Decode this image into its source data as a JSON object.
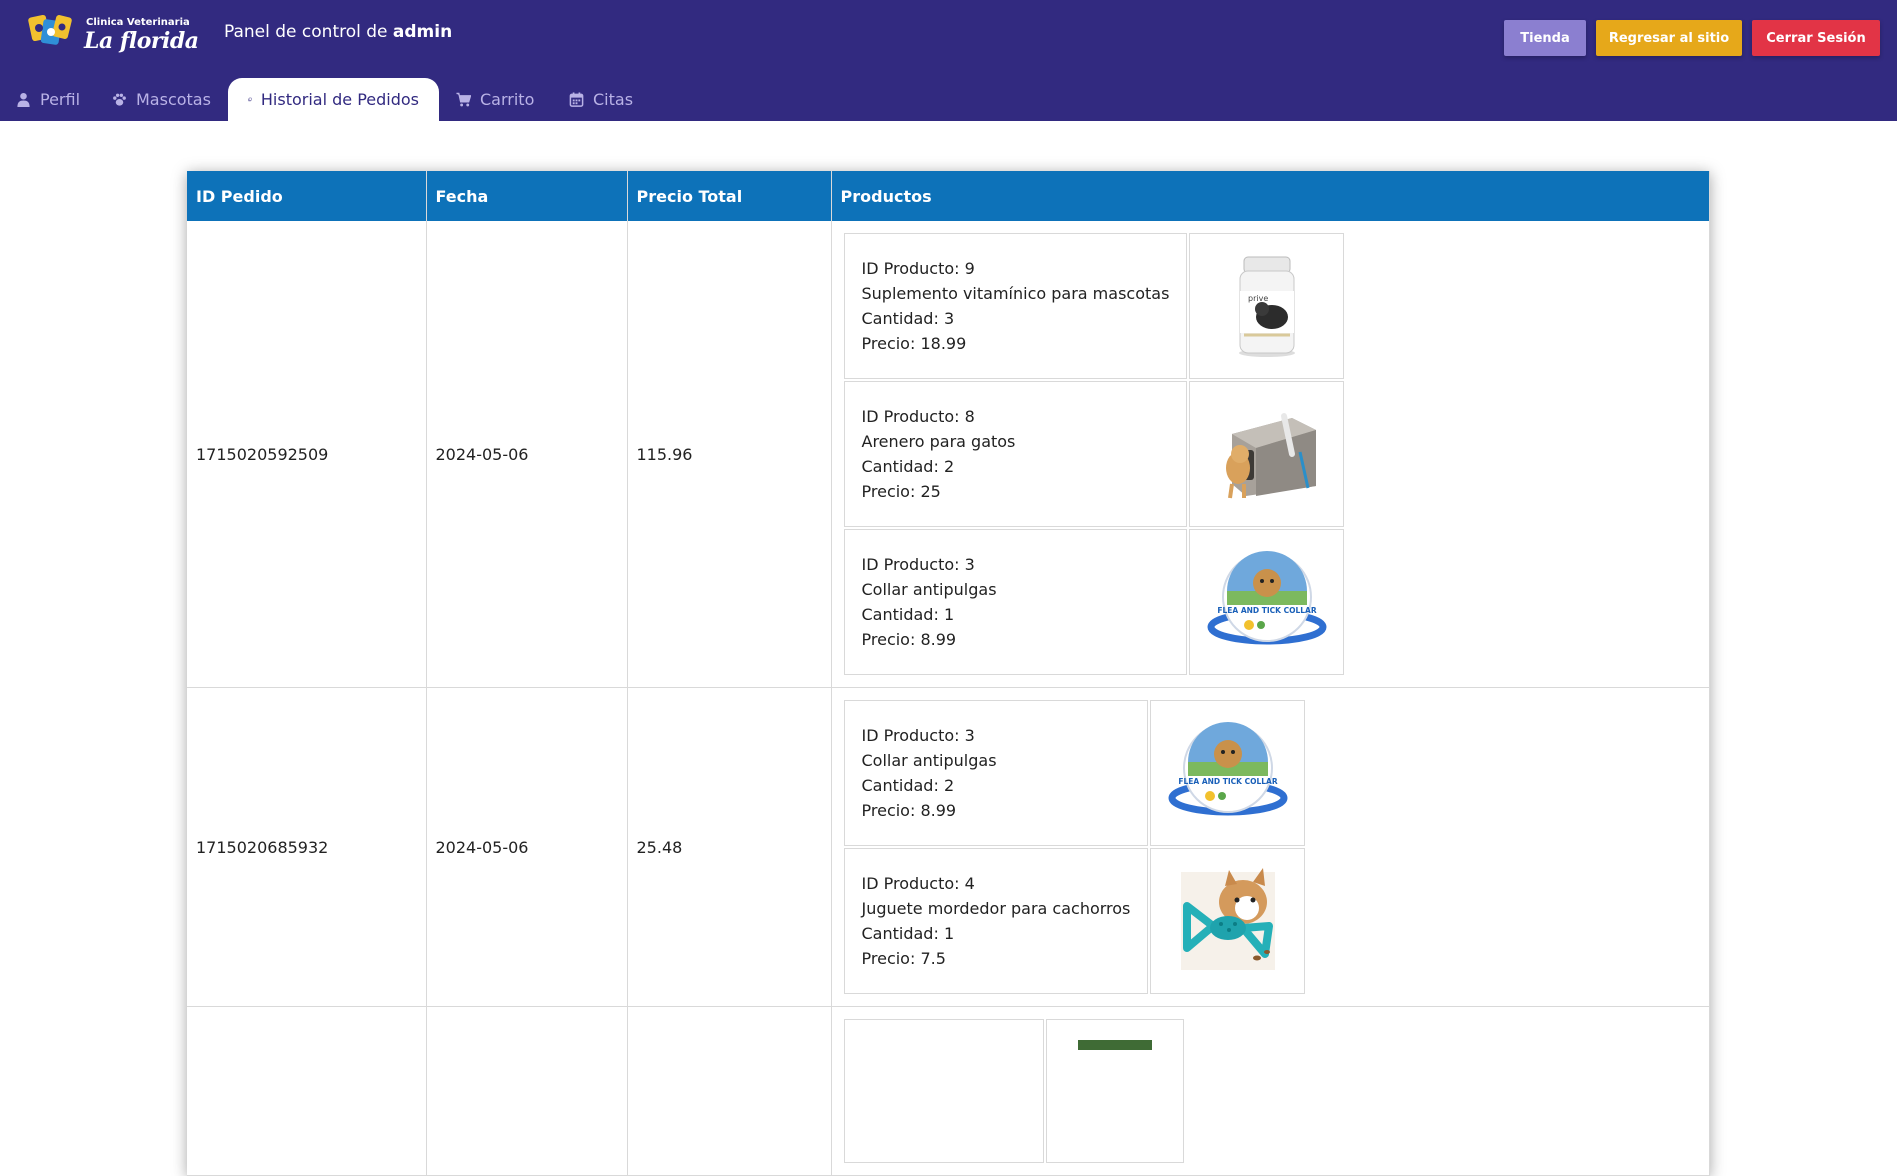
{
  "app": {
    "logo_line1": "Clinica Veterinaria",
    "logo_line2": "La florida",
    "panel_prefix": "Panel de control de ",
    "panel_user": "admin"
  },
  "header_buttons": {
    "tienda": "Tienda",
    "regresar": "Regresar al sitio",
    "cerrar": "Cerrar Sesión"
  },
  "colors": {
    "topbar": "#322a80",
    "tienda": "#8b7fd0",
    "regresar": "#e6a81a",
    "cerrar": "#e23446",
    "table_header": "#0d72b9"
  },
  "tabs": [
    {
      "label": "Perfil",
      "icon": "user-icon"
    },
    {
      "label": "Mascotas",
      "icon": "paw-icon"
    },
    {
      "label": "Historial de Pedidos",
      "icon": "copy-icon",
      "active": true
    },
    {
      "label": "Carrito",
      "icon": "cart-icon"
    },
    {
      "label": "Citas",
      "icon": "calendar-icon"
    }
  ],
  "table": {
    "headers": [
      "ID Pedido",
      "Fecha",
      "Precio Total",
      "Productos"
    ],
    "product_labels": {
      "id": "ID Producto: ",
      "qty": "Cantidad: ",
      "price": "Precio: "
    },
    "orders": [
      {
        "id": "1715020592509",
        "date": "2024-05-06",
        "total": "115.96",
        "products": [
          {
            "id": "9",
            "name": "Suplemento vitamínico para mascotas",
            "qty": "3",
            "price": "18.99",
            "image": "supplement-bottle-image"
          },
          {
            "id": "8",
            "name": "Arenero para gatos",
            "qty": "2",
            "price": "25",
            "image": "cat-litter-box-image"
          },
          {
            "id": "3",
            "name": "Collar antipulgas",
            "qty": "1",
            "price": "8.99",
            "image": "flea-collar-image"
          }
        ]
      },
      {
        "id": "1715020685932",
        "date": "2024-05-06",
        "total": "25.48",
        "products": [
          {
            "id": "3",
            "name": "Collar antipulgas",
            "qty": "2",
            "price": "8.99",
            "image": "flea-collar-image"
          },
          {
            "id": "4",
            "name": "Juguete mordedor para cachorros",
            "qty": "1",
            "price": "7.5",
            "image": "chew-toy-image"
          }
        ]
      }
    ]
  }
}
